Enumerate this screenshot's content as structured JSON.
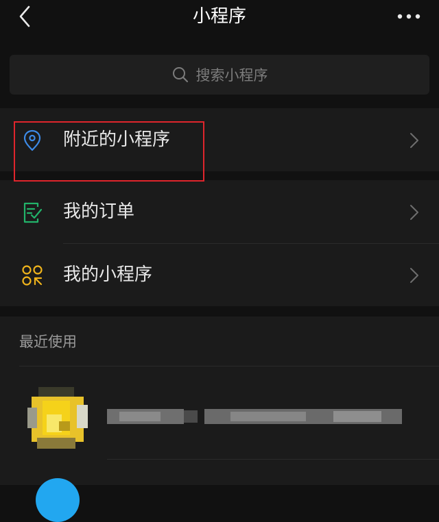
{
  "header": {
    "title": "小程序",
    "back_icon": "chevron-left-icon",
    "more_icon": "more-dots-icon"
  },
  "search": {
    "placeholder": "搜索小程序",
    "icon": "search-icon"
  },
  "menu": [
    {
      "label": "附近的小程序",
      "icon": "location-pin-icon",
      "icon_color": "#3d8be8",
      "highlighted": true
    },
    {
      "label": "我的订单",
      "icon": "order-list-icon",
      "icon_color": "#22b36a"
    },
    {
      "label": "我的小程序",
      "icon": "mini-program-icon",
      "icon_color": "#f0b41c"
    }
  ],
  "recent": {
    "title": "最近使用"
  },
  "colors": {
    "background": "#111111",
    "panel": "#1b1b1b",
    "highlight_border": "#e0252c"
  }
}
